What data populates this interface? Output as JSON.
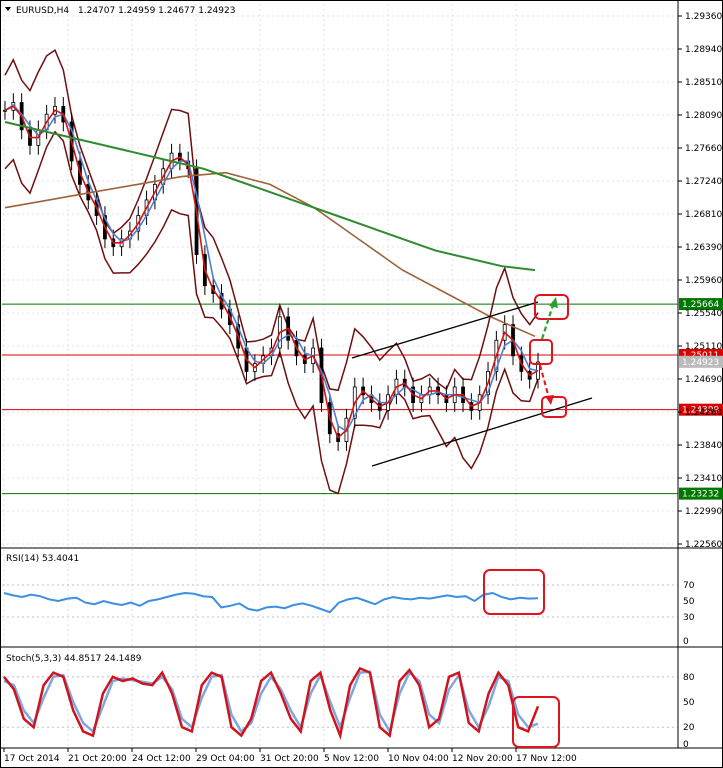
{
  "chart_data": [
    {
      "type": "line",
      "symbol": "EURUSD,H4",
      "ohlc": [
        "1.24707",
        "1.24959",
        "1.24677",
        "1.24923"
      ],
      "ylim": [
        1.2256,
        1.2936
      ],
      "y_ticks": [
        "1.29360",
        "1.28940",
        "1.28510",
        "1.28090",
        "1.27660",
        "1.27240",
        "1.26810",
        "1.26390",
        "1.25960",
        "1.25540",
        "1.25110",
        "1.24690",
        "1.24260",
        "1.23840",
        "1.23410",
        "1.22990",
        "1.22560"
      ],
      "x_labels": [
        "17 Oct 2014",
        "21 Oct 20:00",
        "24 Oct 12:00",
        "29 Oct 04:00",
        "31 Oct 20:00",
        "5 Nov 12:00",
        "10 Nov 04:00",
        "12 Nov 20:00",
        "17 Nov 12:00"
      ],
      "close_path": [
        1.2815,
        1.2825,
        1.279,
        1.277,
        1.279,
        1.281,
        1.282,
        1.28,
        1.275,
        1.272,
        1.27,
        1.268,
        1.265,
        1.264,
        1.265,
        1.266,
        1.268,
        1.27,
        1.272,
        1.274,
        1.276,
        1.275,
        1.274,
        1.263,
        1.259,
        1.258,
        1.256,
        1.254,
        1.251,
        1.248,
        1.249,
        1.25,
        1.251,
        1.255,
        1.252,
        1.25,
        1.249,
        1.251,
        1.244,
        1.24,
        1.239,
        1.242,
        1.246,
        1.245,
        1.244,
        1.243,
        1.245,
        1.247,
        1.246,
        1.244,
        1.245,
        1.246,
        1.245,
        1.244,
        1.246,
        1.244,
        1.243,
        1.245,
        1.248,
        1.252,
        1.254,
        1.25,
        1.248,
        1.247,
        1.2492
      ],
      "sma_green": [
        1.28,
        1.279,
        1.278,
        1.277,
        1.276,
        1.275,
        1.274,
        1.2725,
        1.271,
        1.2695,
        1.268,
        1.2665,
        1.265,
        1.2635,
        1.2625,
        1.2615,
        1.261
      ],
      "sma_brown": [
        1.269,
        1.27,
        1.271,
        1.272,
        1.273,
        1.2735,
        1.272,
        1.269,
        1.265,
        1.261,
        1.258,
        1.255,
        1.2525
      ],
      "horizontal_levels": [
        {
          "value": 1.25664,
          "label": "1.25664",
          "color": "#007700"
        },
        {
          "value": 1.25011,
          "label": "1.25011",
          "color": "#dd0000"
        },
        {
          "value": 1.24923,
          "label": "1.24923",
          "color": "#bbbbbb"
        },
        {
          "value": 1.24309,
          "label": "1.24309",
          "color": "#dd0000"
        },
        {
          "value": 1.23232,
          "label": "1.23232",
          "color": "#007700"
        }
      ]
    },
    {
      "type": "line",
      "title": "RSI(14) 53.4041",
      "ylim": [
        0,
        100
      ],
      "y_ticks": [
        "70",
        "50",
        "30",
        "0"
      ],
      "values": [
        60,
        57,
        55,
        58,
        56,
        52,
        50,
        53,
        54,
        48,
        46,
        50,
        47,
        45,
        48,
        44,
        50,
        52,
        55,
        58,
        60,
        59,
        56,
        55,
        42,
        44,
        47,
        40,
        38,
        42,
        43,
        41,
        45,
        47,
        44,
        40,
        36,
        48,
        52,
        54,
        50,
        46,
        52,
        55,
        53,
        52,
        54,
        53,
        55,
        57,
        55,
        56,
        50,
        58,
        60,
        55,
        52,
        54,
        53,
        53.4
      ]
    },
    {
      "type": "line",
      "title": "Stoch(5,3,3) 44.8517 24.1489",
      "ylim": [
        0,
        100
      ],
      "y_ticks": [
        "80",
        "50",
        "20",
        "0"
      ],
      "main": [
        80,
        65,
        30,
        20,
        70,
        85,
        80,
        40,
        15,
        10,
        60,
        80,
        75,
        78,
        72,
        70,
        85,
        60,
        20,
        15,
        70,
        85,
        80,
        20,
        10,
        30,
        75,
        85,
        60,
        30,
        15,
        75,
        85,
        40,
        10,
        70,
        90,
        85,
        20,
        10,
        75,
        88,
        70,
        20,
        30,
        80,
        85,
        25,
        15,
        60,
        85,
        70,
        20,
        15,
        44.85
      ],
      "signal": [
        75,
        70,
        40,
        25,
        55,
        80,
        82,
        50,
        25,
        15,
        45,
        75,
        78,
        76,
        74,
        72,
        80,
        65,
        30,
        20,
        55,
        80,
        82,
        35,
        15,
        25,
        60,
        80,
        65,
        40,
        20,
        60,
        82,
        50,
        20,
        55,
        85,
        86,
        35,
        15,
        60,
        85,
        75,
        35,
        25,
        65,
        82,
        40,
        20,
        45,
        80,
        75,
        35,
        20,
        24.15
      ]
    }
  ]
}
